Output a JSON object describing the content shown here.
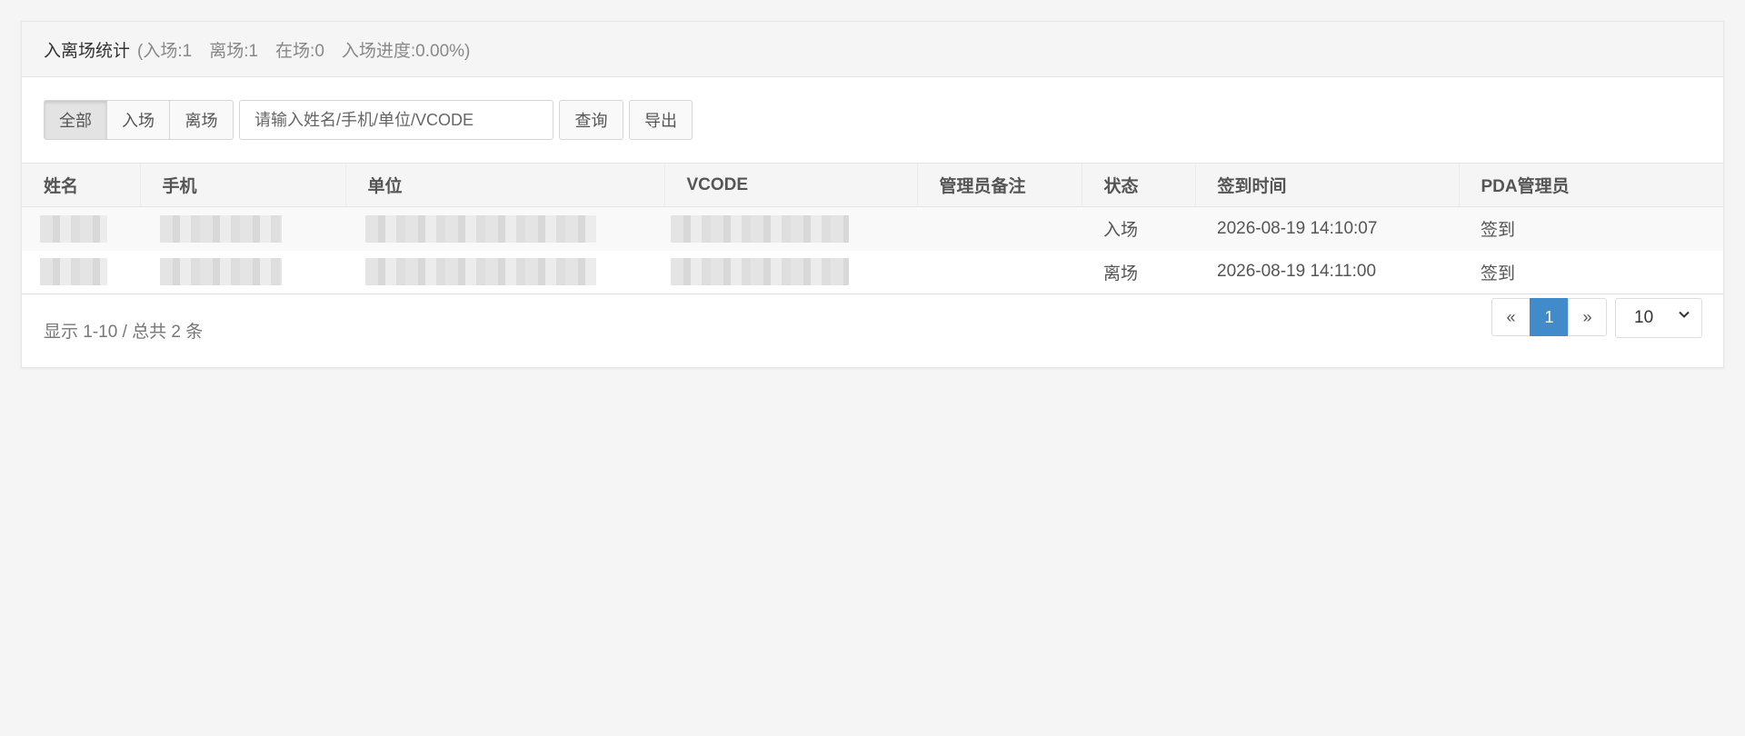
{
  "header": {
    "title": "入离场统计",
    "summary": "(入场:1　离场:1　在场:0　入场进度:0.00%)"
  },
  "toolbar": {
    "filters": [
      "全部",
      "入场",
      "离场"
    ],
    "active_filter": "全部",
    "search_placeholder": "请输入姓名/手机/单位/VCODE",
    "query_label": "查询",
    "export_label": "导出"
  },
  "table": {
    "columns": [
      "姓名",
      "手机",
      "单位",
      "VCODE",
      "管理员备注",
      "状态",
      "签到时间",
      "PDA管理员"
    ],
    "rows": [
      {
        "status": "入场",
        "time": "2026-08-19 14:10:07",
        "pda": "签到"
      },
      {
        "status": "离场",
        "time": "2026-08-19 14:11:00",
        "pda": "签到"
      }
    ]
  },
  "footer": {
    "info": "显示 1-10 / 总共 2 条",
    "prev": "«",
    "current_page": "1",
    "next": "»",
    "page_size": "10"
  },
  "colors": {
    "accent": "#428bca"
  }
}
